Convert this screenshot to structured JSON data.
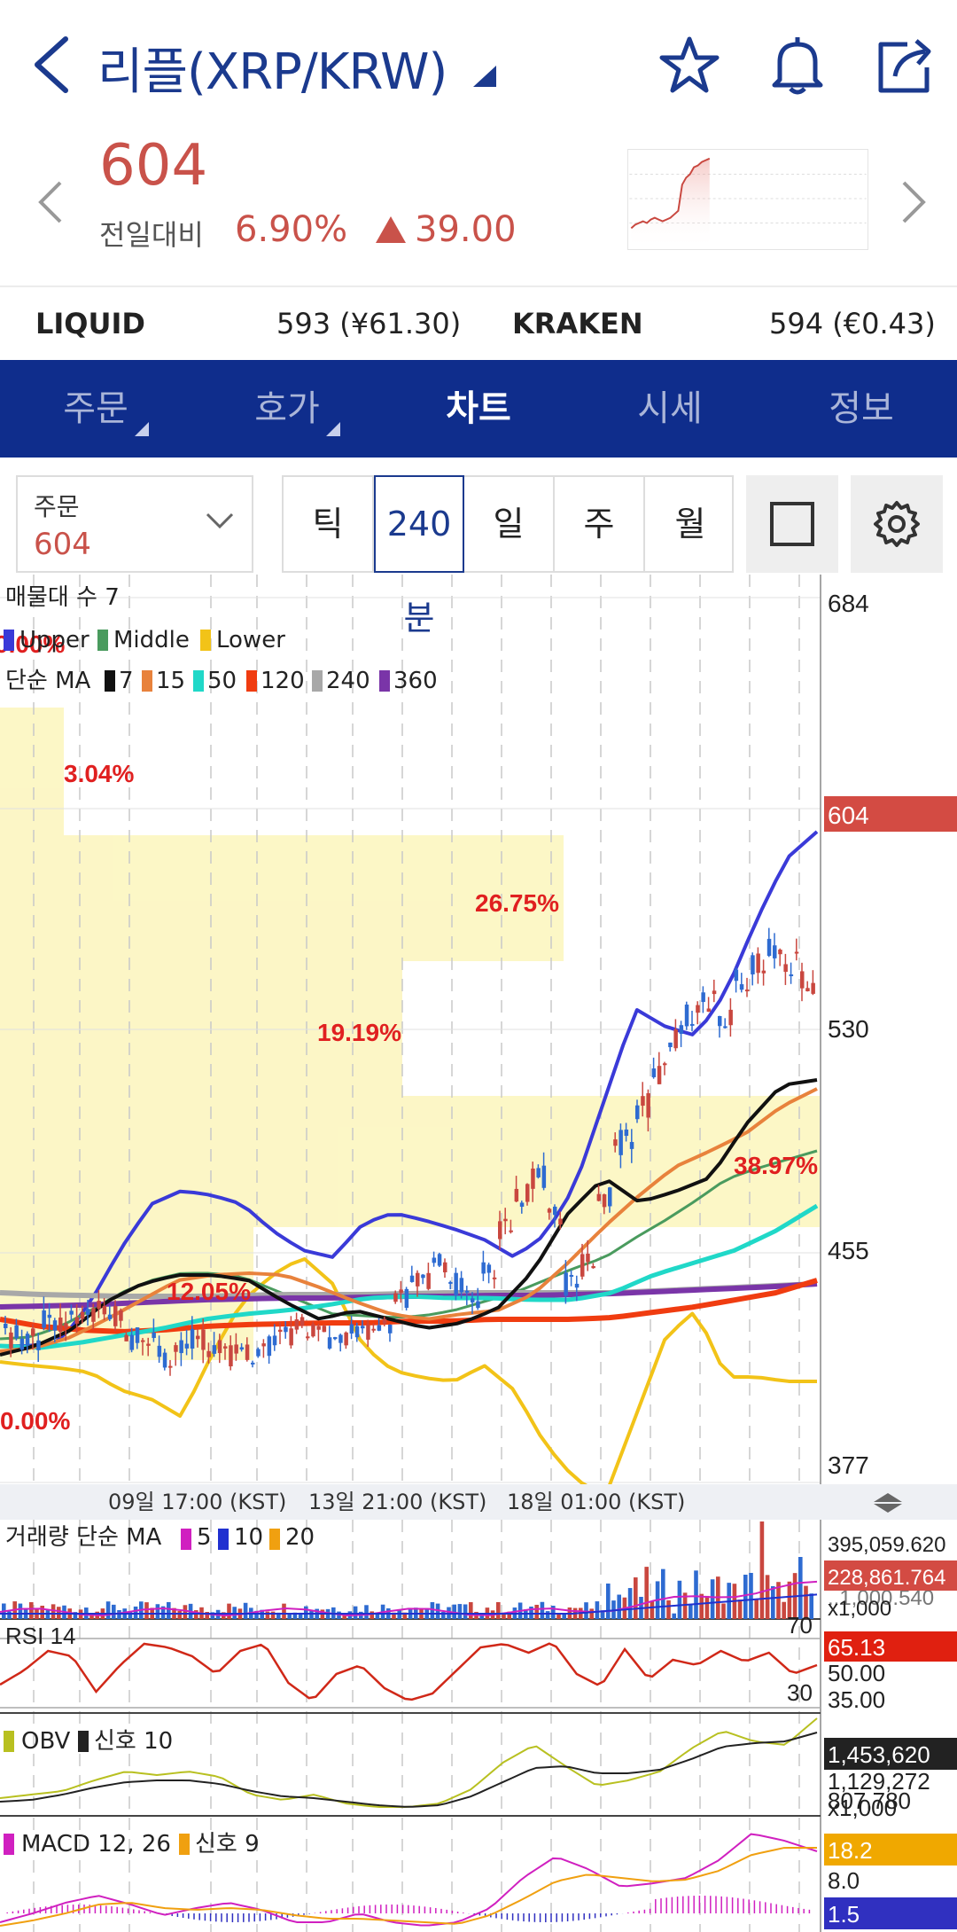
{
  "header": {
    "title": "리플(XRP/KRW)"
  },
  "price": {
    "current": "604",
    "change_label": "전일대비",
    "change_pct": "6.90%",
    "change_value": "39.00"
  },
  "exchanges": [
    {
      "name": "LIQUID",
      "value": "593 (¥61.30)"
    },
    {
      "name": "KRAKEN",
      "value": "594 (€0.43)"
    }
  ],
  "tabs": [
    {
      "label": "주문",
      "active": false
    },
    {
      "label": "호가",
      "active": false
    },
    {
      "label": "차트",
      "active": true
    },
    {
      "label": "시세",
      "active": false
    },
    {
      "label": "정보",
      "active": false
    }
  ],
  "order_select": {
    "label": "주문",
    "value": "604"
  },
  "periods": [
    {
      "label": "틱",
      "selected": false
    },
    {
      "label": "240분",
      "selected": true
    },
    {
      "label": "일",
      "selected": false
    },
    {
      "label": "주",
      "selected": false
    },
    {
      "label": "월",
      "selected": false
    }
  ],
  "chart_legend": {
    "volume_profile": "매물대 수 7",
    "bollinger": [
      "Upper",
      "Middle",
      "Lower"
    ],
    "ma_title": "단순 MA",
    "ma_periods": [
      "7",
      "15",
      "50",
      "120",
      "240",
      "360"
    ]
  },
  "colors": {
    "up": "#c9473f",
    "down": "#2e6bd1",
    "upper": "#3a3ad8",
    "middle": "#4a9b5e",
    "lower": "#f2c318",
    "ma7": "#111111",
    "ma15": "#e8823c",
    "ma50": "#20d8c8",
    "ma120": "#f03c10",
    "ma240": "#a8a8a8",
    "ma360": "#7a35a8",
    "tab_bg": "#0f2d8c"
  },
  "volume_profile_labels": [
    "0.00%",
    "3.04%",
    "26.75%",
    "19.19%",
    "38.97%",
    "12.05%",
    "0.00%"
  ],
  "x_axis_labels": [
    "09일 17:00 (KST)",
    "13일 21:00 (KST)",
    "18일 01:00 (KST)"
  ],
  "volume_panel": {
    "title": "거래량 단순 MA",
    "mas": [
      "5",
      "10",
      "20"
    ],
    "labels": [
      "395,059.620",
      "228,861.764",
      "x1,000"
    ],
    "overlap_label": "..1,000.540"
  },
  "rsi_panel": {
    "title": "RSI 14",
    "labels": [
      "70",
      "65.13",
      "50.00",
      "35.00",
      "30"
    ]
  },
  "obv_panel": {
    "title": "OBV",
    "signal": "신호 10",
    "labels": [
      "1,453,620",
      "1,129,272",
      "807,780",
      "x1,000"
    ]
  },
  "macd_panel": {
    "title": "MACD 12, 26",
    "signal": "신호 9",
    "labels": [
      "18.2",
      "8.0",
      "1.5"
    ]
  },
  "chart_data": {
    "type": "candlestick",
    "y_axis_ticks": [
      684,
      604,
      530,
      455,
      377
    ],
    "last_price": 604,
    "ylim": [
      377,
      684
    ]
  }
}
